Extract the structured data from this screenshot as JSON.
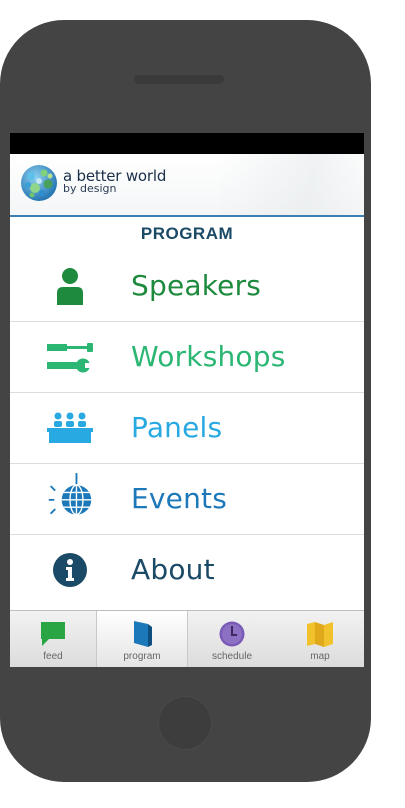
{
  "app": {
    "logo_line1": "a better world",
    "logo_line2": "by design"
  },
  "section": {
    "title": "PROGRAM"
  },
  "menu": {
    "items": [
      {
        "label": "Speakers",
        "icon": "speaker-person-icon",
        "color": "#1e8a3e"
      },
      {
        "label": "Workshops",
        "icon": "tools-icon",
        "color": "#2bb673"
      },
      {
        "label": "Panels",
        "icon": "panel-table-icon",
        "color": "#29a9e1"
      },
      {
        "label": "Events",
        "icon": "disco-ball-icon",
        "color": "#1c78b8"
      },
      {
        "label": "About",
        "icon": "info-icon",
        "color": "#1b4a66"
      }
    ]
  },
  "tabs": [
    {
      "label": "feed",
      "icon": "chat-bubble-icon",
      "color": "#2aa544"
    },
    {
      "label": "program",
      "icon": "bookmark-flag-icon",
      "color": "#1c78b8",
      "active": true
    },
    {
      "label": "schedule",
      "icon": "clock-icon",
      "color": "#7a5bb5"
    },
    {
      "label": "map",
      "icon": "map-icon",
      "color": "#f2c22e"
    }
  ],
  "colors": {
    "header_rule": "#3c7fb4",
    "phone_body": "#444444"
  }
}
